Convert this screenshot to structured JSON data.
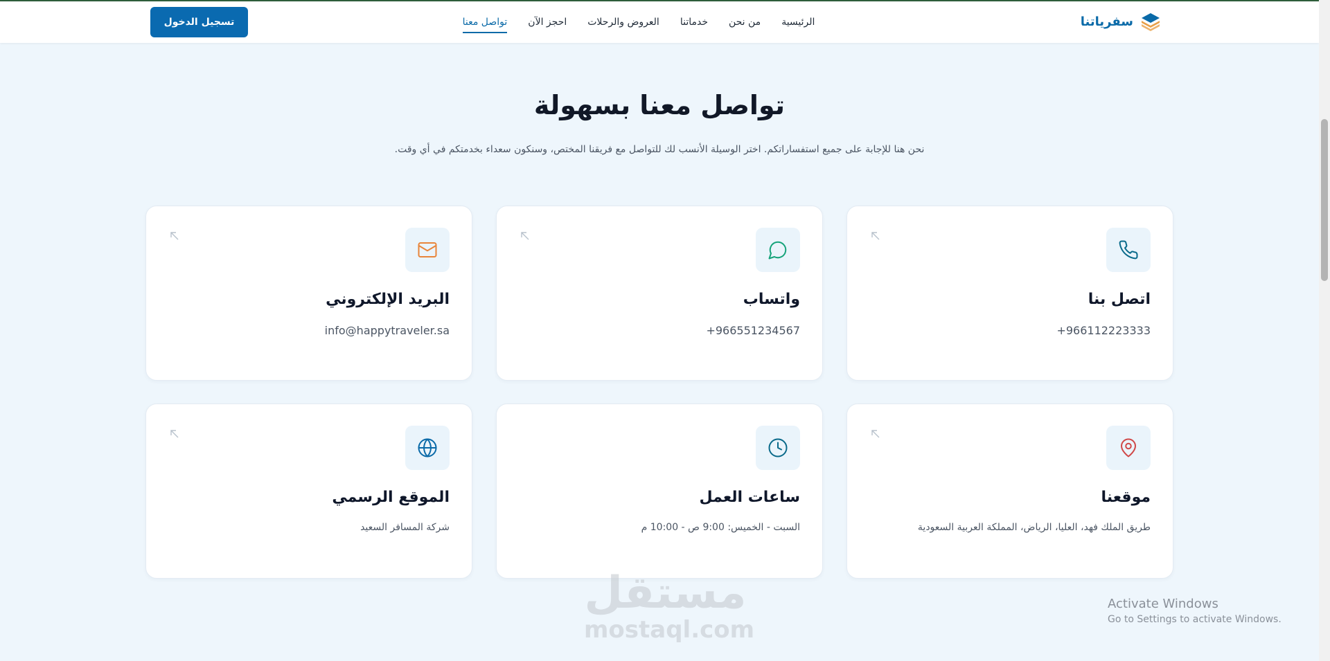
{
  "header": {
    "brand_name": "سفرياتنا",
    "login_label": "تسجيل الدخول",
    "nav": [
      {
        "label": "الرئيسية",
        "active": false
      },
      {
        "label": "من نحن",
        "active": false
      },
      {
        "label": "خدماتنا",
        "active": false
      },
      {
        "label": "العروض والرحلات",
        "active": false
      },
      {
        "label": "احجز الآن",
        "active": false
      },
      {
        "label": "تواصل معنا",
        "active": true
      }
    ]
  },
  "hero": {
    "title": "تواصل معنا بسهولة",
    "subtitle": "نحن هنا للإجابة على جميع استفساراتكم. اختر الوسيلة الأنسب لك للتواصل مع فريقنا المختص، وسنكون سعداء بخدمتكم في أي وقت."
  },
  "cards": [
    {
      "title": "اتصل بنا",
      "value": "+966112223333",
      "icon": "phone-icon",
      "color": "#0a6a8a"
    },
    {
      "title": "واتساب",
      "value": "+966551234567",
      "icon": "whatsapp-icon",
      "color": "#16a37a"
    },
    {
      "title": "البريد الإلكتروني",
      "value": "info@happytraveler.sa",
      "icon": "mail-icon",
      "color": "#e8853a"
    },
    {
      "title": "موقعنا",
      "value": "طريق الملك فهد، العليا، الرياض، المملكة العربية السعودية",
      "icon": "map-pin-icon",
      "color": "#d04848"
    },
    {
      "title": "ساعات العمل",
      "value": "السبت - الخميس: 9:00 ص - 10:00 م",
      "icon": "clock-icon",
      "color": "#0a6a8a"
    },
    {
      "title": "الموقع الرسمي",
      "value": "شركة المسافر السعيد",
      "icon": "globe-icon",
      "color": "#0a6aa8"
    }
  ],
  "watermark": {
    "arabic": "مستقل",
    "latin": "mostaql.com"
  },
  "os_notice": {
    "title": "Activate Windows",
    "subtitle": "Go to Settings to activate Windows."
  }
}
